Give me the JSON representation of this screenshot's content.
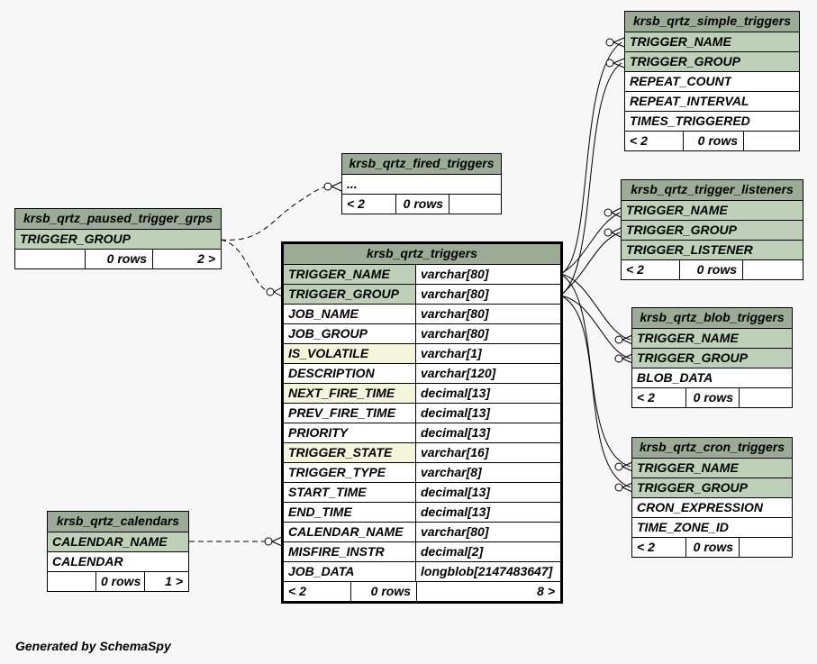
{
  "footer_text": "Generated by SchemaSpy",
  "tables": {
    "simple_triggers": {
      "title": "krsb_qrtz_simple_triggers",
      "columns": [
        "TRIGGER_NAME",
        "TRIGGER_GROUP",
        "REPEAT_COUNT",
        "REPEAT_INTERVAL",
        "TIMES_TRIGGERED"
      ],
      "footer": [
        "< 2",
        "0 rows",
        ""
      ]
    },
    "fired_triggers": {
      "title": "krsb_qrtz_fired_triggers",
      "columns": [
        "..."
      ],
      "footer": [
        "< 2",
        "0 rows",
        ""
      ]
    },
    "paused_trigger_grps": {
      "title": "krsb_qrtz_paused_trigger_grps",
      "columns": [
        "TRIGGER_GROUP"
      ],
      "footer": [
        "",
        "0 rows",
        "2 >"
      ]
    },
    "trigger_listeners": {
      "title": "krsb_qrtz_trigger_listeners",
      "columns": [
        "TRIGGER_NAME",
        "TRIGGER_GROUP",
        "TRIGGER_LISTENER"
      ],
      "footer": [
        "< 2",
        "0 rows",
        ""
      ]
    },
    "triggers": {
      "title": "krsb_qrtz_triggers",
      "columns": [
        {
          "name": "TRIGGER_NAME",
          "type": "varchar[80]"
        },
        {
          "name": "TRIGGER_GROUP",
          "type": "varchar[80]"
        },
        {
          "name": "JOB_NAME",
          "type": "varchar[80]"
        },
        {
          "name": "JOB_GROUP",
          "type": "varchar[80]"
        },
        {
          "name": "IS_VOLATILE",
          "type": "varchar[1]"
        },
        {
          "name": "DESCRIPTION",
          "type": "varchar[120]"
        },
        {
          "name": "NEXT_FIRE_TIME",
          "type": "decimal[13]"
        },
        {
          "name": "PREV_FIRE_TIME",
          "type": "decimal[13]"
        },
        {
          "name": "PRIORITY",
          "type": "decimal[13]"
        },
        {
          "name": "TRIGGER_STATE",
          "type": "varchar[16]"
        },
        {
          "name": "TRIGGER_TYPE",
          "type": "varchar[8]"
        },
        {
          "name": "START_TIME",
          "type": "decimal[13]"
        },
        {
          "name": "END_TIME",
          "type": "decimal[13]"
        },
        {
          "name": "CALENDAR_NAME",
          "type": "varchar[80]"
        },
        {
          "name": "MISFIRE_INSTR",
          "type": "decimal[2]"
        },
        {
          "name": "JOB_DATA",
          "type": "longblob[2147483647]"
        }
      ],
      "footer": [
        "< 2",
        "0 rows",
        "8 >"
      ]
    },
    "blob_triggers": {
      "title": "krsb_qrtz_blob_triggers",
      "columns": [
        "TRIGGER_NAME",
        "TRIGGER_GROUP",
        "BLOB_DATA"
      ],
      "footer": [
        "< 2",
        "0 rows",
        ""
      ]
    },
    "cron_triggers": {
      "title": "krsb_qrtz_cron_triggers",
      "columns": [
        "TRIGGER_NAME",
        "TRIGGER_GROUP",
        "CRON_EXPRESSION",
        "TIME_ZONE_ID"
      ],
      "footer": [
        "< 2",
        "0 rows",
        ""
      ]
    },
    "calendars": {
      "title": "krsb_qrtz_calendars",
      "columns": [
        "CALENDAR_NAME",
        "CALENDAR"
      ],
      "footer": [
        "",
        "0 rows",
        "1 >"
      ]
    }
  }
}
